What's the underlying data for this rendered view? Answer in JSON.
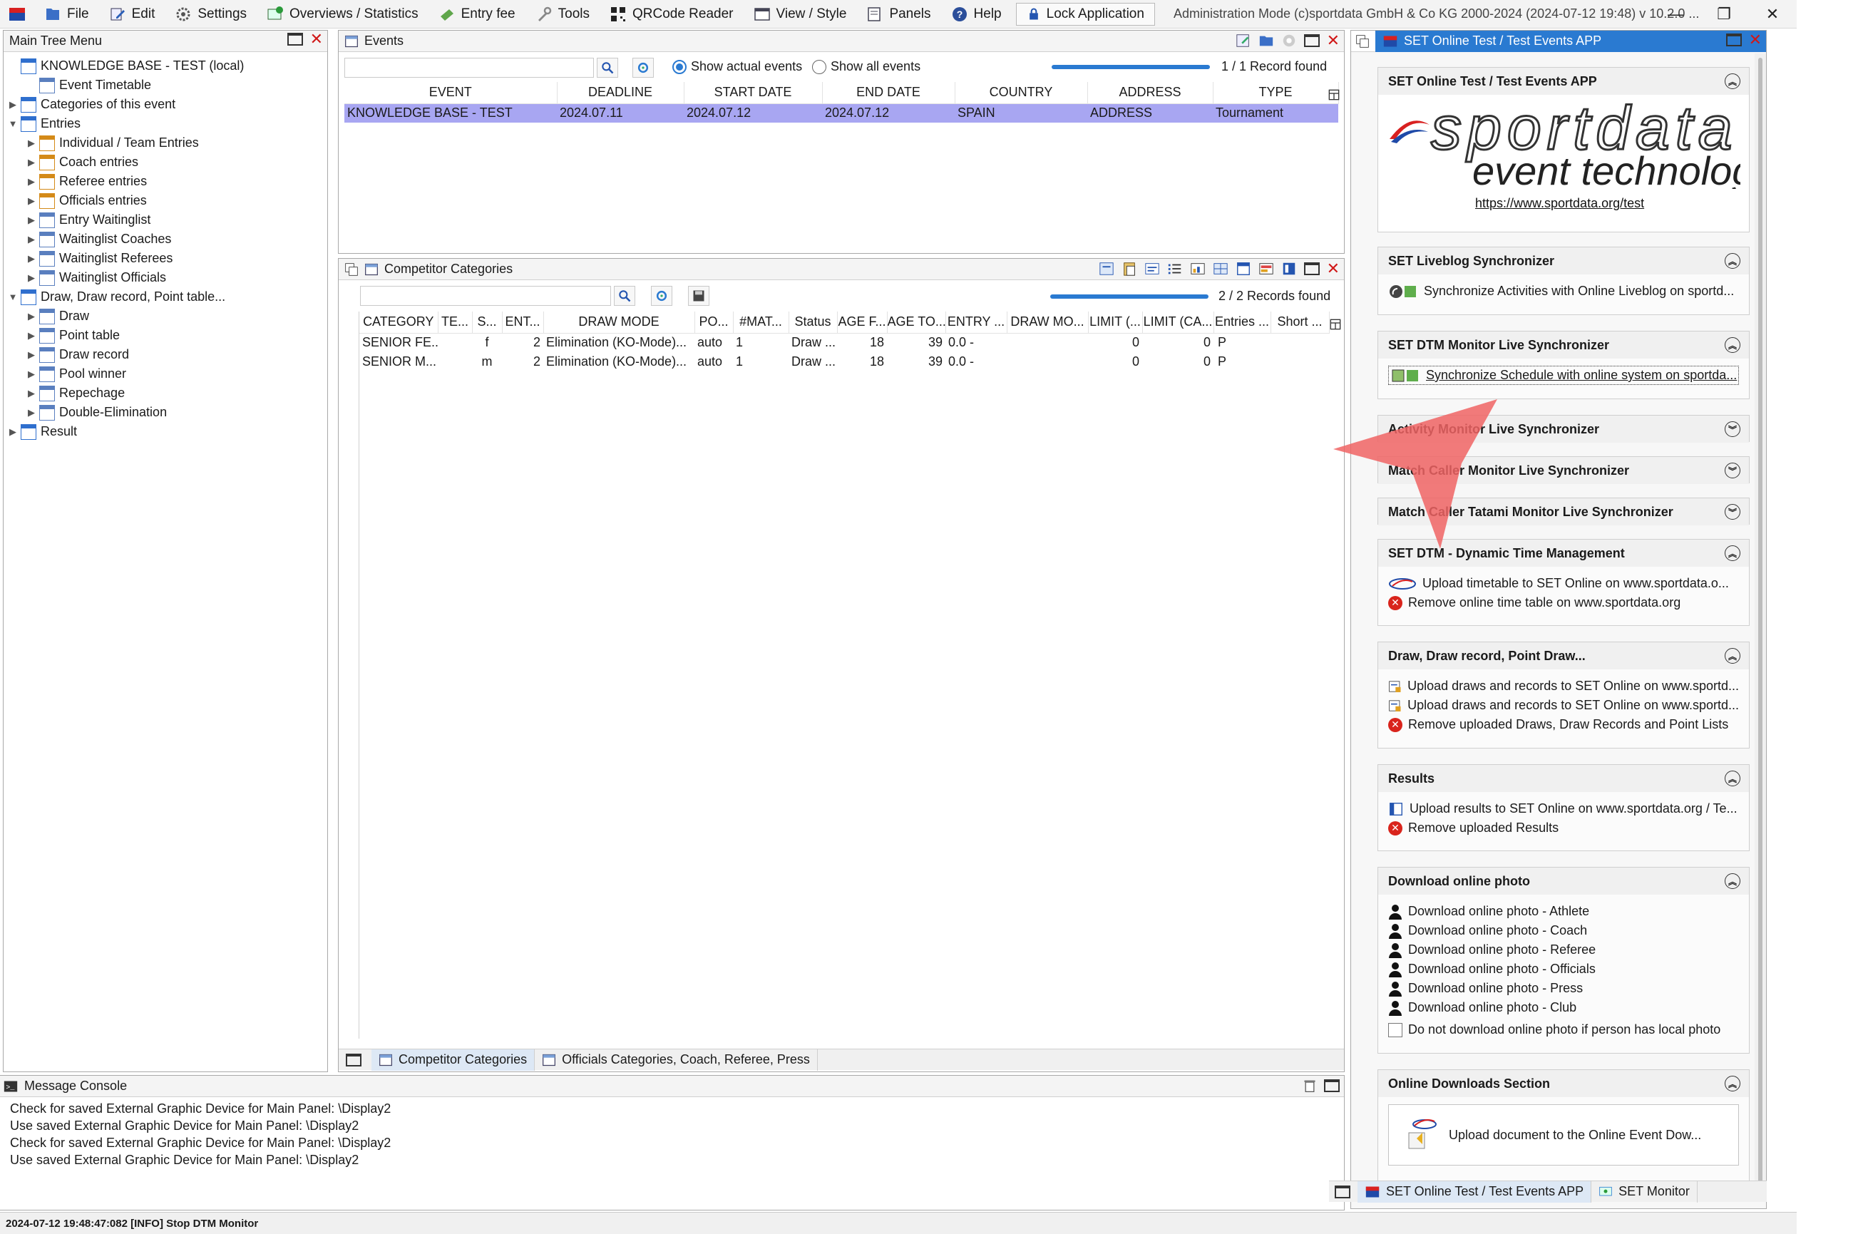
{
  "menubar": {
    "items": [
      "File",
      "Edit",
      "Settings",
      "Overviews / Statistics",
      "Entry fee",
      "Tools",
      "QRCode Reader",
      "View / Style",
      "Panels",
      "Help"
    ],
    "lock_label": "Lock Application",
    "title": "Administration Mode (c)sportdata GmbH & Co KG 2000-2024 (2024-07-12 19:48)  v 10.2.0 ..."
  },
  "tree": {
    "title": "Main Tree Menu",
    "rows": [
      {
        "label": "KNOWLEDGE BASE - TEST (local)",
        "level": 0,
        "twisty": ""
      },
      {
        "label": "Event Timetable",
        "level": 1,
        "twisty": ""
      },
      {
        "label": "Categories of this event",
        "level": 0,
        "twisty": "▶"
      },
      {
        "label": "Entries",
        "level": 0,
        "twisty": "▼"
      },
      {
        "label": "Individual / Team Entries",
        "level": 1,
        "twisty": "▶"
      },
      {
        "label": "Coach entries",
        "level": 1,
        "twisty": "▶"
      },
      {
        "label": "Referee entries",
        "level": 1,
        "twisty": "▶"
      },
      {
        "label": "Officials entries",
        "level": 1,
        "twisty": "▶"
      },
      {
        "label": "Entry Waitinglist",
        "level": 1,
        "twisty": "▶"
      },
      {
        "label": "Waitinglist Coaches",
        "level": 1,
        "twisty": "▶"
      },
      {
        "label": "Waitinglist Referees",
        "level": 1,
        "twisty": "▶"
      },
      {
        "label": "Waitinglist Officials",
        "level": 1,
        "twisty": "▶"
      },
      {
        "label": "Draw, Draw record, Point table...",
        "level": 0,
        "twisty": "▼"
      },
      {
        "label": "Draw",
        "level": 1,
        "twisty": "▶"
      },
      {
        "label": "Point table",
        "level": 1,
        "twisty": "▶"
      },
      {
        "label": "Draw record",
        "level": 1,
        "twisty": "▶"
      },
      {
        "label": "Pool winner",
        "level": 1,
        "twisty": "▶"
      },
      {
        "label": "Repechage",
        "level": 1,
        "twisty": "▶"
      },
      {
        "label": "Double-Elimination",
        "level": 1,
        "twisty": "▶"
      },
      {
        "label": "Result",
        "level": 0,
        "twisty": "▶"
      }
    ]
  },
  "events": {
    "title": "Events",
    "radio_actual": "Show actual events",
    "radio_all": "Show all events",
    "record_count": "1 / 1 Record found",
    "columns": [
      "EVENT",
      "DEADLINE",
      "START DATE",
      "END DATE",
      "COUNTRY",
      "ADDRESS",
      "TYPE"
    ],
    "rows": [
      [
        "KNOWLEDGE BASE - TEST",
        "2024.07.11",
        "2024.07.12",
        "2024.07.12",
        "SPAIN",
        "ADDRESS",
        "Tournament"
      ]
    ]
  },
  "categories": {
    "title": "Competitor Categories",
    "record_count": "2 / 2 Records found",
    "columns": [
      "CATEGORY",
      "TE...",
      "S...",
      "ENT...",
      "DRAW MODE",
      "PO...",
      "#MAT...",
      "Status",
      "AGE F...",
      "AGE TO...",
      "ENTRY ...",
      "DRAW MO...",
      "LIMIT (...",
      "LIMIT (CA...",
      "Entries ...",
      "Short ..."
    ],
    "rows": [
      [
        "SENIOR FE...",
        "",
        "f",
        "2",
        "Elimination (KO-Mode)...",
        "auto",
        "1",
        "Draw ...",
        "18",
        "39",
        "0.0 -",
        "",
        "0",
        "0",
        "P",
        ""
      ],
      [
        "SENIOR M...",
        "",
        "m",
        "2",
        "Elimination (KO-Mode)...",
        "auto",
        "1",
        "Draw ...",
        "18",
        "39",
        "0.0 -",
        "",
        "0",
        "0",
        "P",
        ""
      ]
    ],
    "tabs": [
      "Competitor Categories",
      "Officials Categories, Coach, Referee, Press"
    ]
  },
  "console": {
    "title": "Message Console",
    "lines": [
      "Check for saved External Graphic Device for Main Panel: \\Display2",
      "Use saved External Graphic Device for Main Panel: \\Display2",
      "Check for saved External Graphic Device for Main Panel: \\Display2",
      "Use saved External Graphic Device for Main Panel: \\Display2"
    ]
  },
  "status_bar": "2024-07-12 19:48:47:082 [INFO] Stop DTM Monitor",
  "set_online": {
    "title": "SET Online Test / Test Events APP",
    "logo_top": "sportdata",
    "logo_bottom": "event technology",
    "sections": [
      {
        "title": "SET Online Test / Test Events APP",
        "link": "https://www.sportdata.org/test"
      },
      {
        "title": "SET Liveblog Synchronizer",
        "items": [
          "Synchronize Activities with Online Liveblog on sportd..."
        ]
      },
      {
        "title": "SET DTM Monitor Live Synchronizer",
        "items": [
          "Synchronize Schedule with online system on sportda..."
        ]
      },
      {
        "title": "Activity Monitor Live Synchronizer"
      },
      {
        "title": "Match Caller Monitor Live Synchronizer"
      },
      {
        "title": "Match Caller Tatami Monitor Live Synchronizer"
      },
      {
        "title": "SET DTM - Dynamic Time Management",
        "items": [
          "Upload timetable to SET Online on www.sportdata.o...",
          "Remove online time table on www.sportdata.org"
        ]
      },
      {
        "title": "Draw, Draw record, Point Draw...",
        "items": [
          "Upload draws and records to SET Online on www.sportd...",
          "Upload draws and records to SET Online on www.sportd...",
          "Remove uploaded Draws, Draw Records and Point Lists"
        ]
      },
      {
        "title": "Results",
        "items": [
          "Upload results to SET Online on www.sportdata.org / Te...",
          "Remove uploaded Results"
        ]
      },
      {
        "title": "Download online photo",
        "items": [
          "Download online photo - Athlete",
          "Download online photo - Coach",
          "Download online photo - Referee",
          "Download online photo - Officials",
          "Download online photo - Press",
          "Download online photo - Club"
        ],
        "checkbox": "Do not download online photo if person has local photo"
      },
      {
        "title": "Online Downloads Section",
        "items": [
          "Upload document to the Online Event Dow..."
        ]
      }
    ],
    "tabs": [
      "SET Online Test / Test Events APP",
      "SET Monitor"
    ]
  },
  "colors": {
    "selection": "#a8a6f2",
    "accent": "#2a7ad1",
    "danger": "#d9241c",
    "entries_badge": "#f5f51a",
    "pointer": "#f06464"
  }
}
